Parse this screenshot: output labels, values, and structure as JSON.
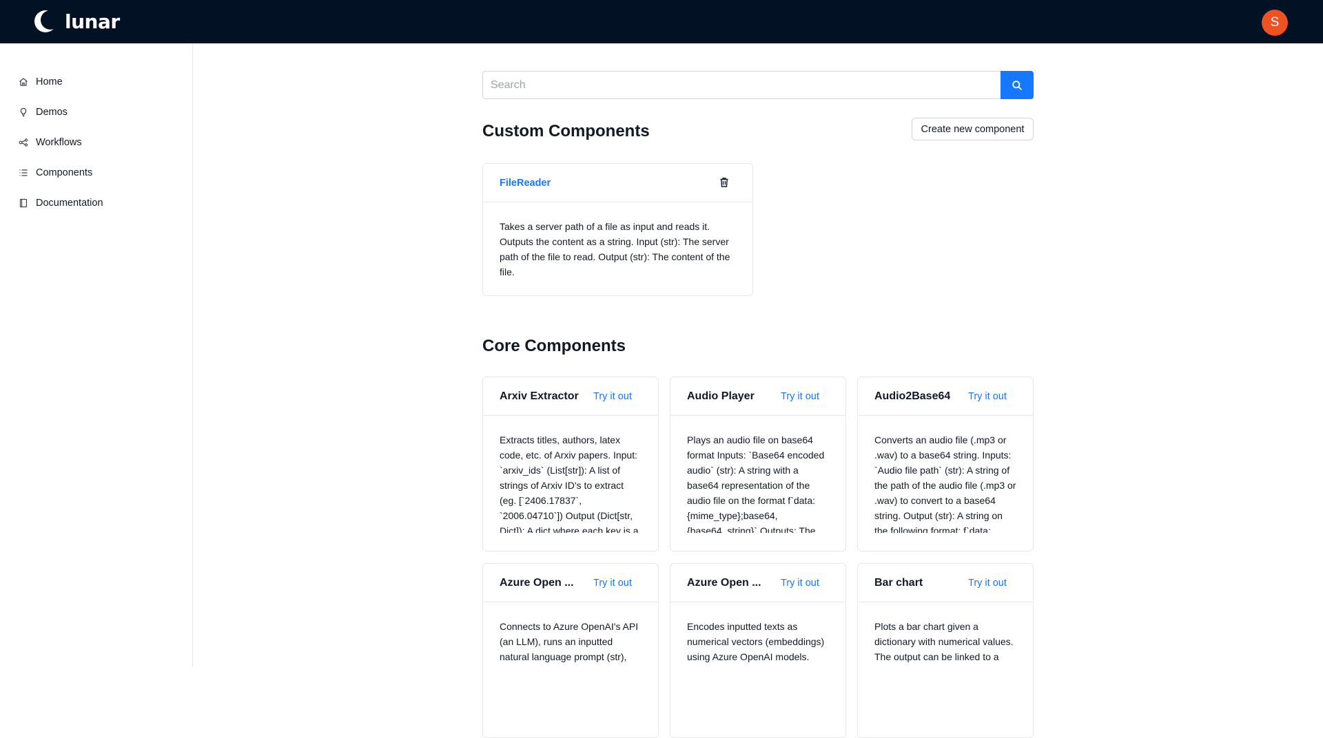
{
  "app": {
    "logo_text": "lunar",
    "avatar_initial": "S",
    "accent_color": "#1677ff",
    "topbar_color": "#021124",
    "avatar_color": "#f05123"
  },
  "sidebar": {
    "items": [
      {
        "label": "Home",
        "icon": "home-icon"
      },
      {
        "label": "Demos",
        "icon": "lightbulb-icon"
      },
      {
        "label": "Workflows",
        "icon": "workflow-icon"
      },
      {
        "label": "Components",
        "icon": "list-icon"
      },
      {
        "label": "Documentation",
        "icon": "book-icon"
      }
    ]
  },
  "search": {
    "placeholder": "Search",
    "value": ""
  },
  "custom": {
    "title": "Custom Components",
    "create_label": "Create new component",
    "cards": [
      {
        "name": "FileReader",
        "description": "Takes a server path of a file as input and reads it. Outputs the content as a string. Input (str): The server path of the file to read. Output (str): The content of the file."
      }
    ]
  },
  "core": {
    "title": "Core Components",
    "try_label": "Try it out",
    "cards": [
      {
        "name": "Arxiv Extractor",
        "description": "Extracts titles, authors, latex code, etc. of Arxiv papers. Input: `arxiv_ids` (List[str]): A list of strings of Arxiv ID's to extract (eg. [`2406.17837`, `2006.04710`]) Output (Dict[str, Dict]): A dict where each key is a"
      },
      {
        "name": "Audio Player",
        "description": "Plays an audio file on base64 format Inputs: `Base64 encoded audio` (str): A string with a base64 representation of the audio file on the format f`data:{mime_type};base64,{base64_string}` Outputs: The"
      },
      {
        "name": "Audio2Base64",
        "description": "Converts an audio file (.mp3 or .wav) to a base64 string. Inputs: `Audio file path` (str): A string of the path of the audio file (.mp3 or .wav) to convert to a base64 string. Output (str): A string on the following format: f`data:"
      },
      {
        "name": "Azure Open ...",
        "description": "Connects to Azure OpenAI's API (an LLM), runs an inputted natural language prompt (str),"
      },
      {
        "name": "Azure Open ...",
        "description": "Encodes inputted texts as numerical vectors (embeddings) using Azure OpenAI models."
      },
      {
        "name": "Bar chart",
        "description": "Plots a bar chart given a dictionary with numerical values. The output can be linked to a"
      }
    ]
  }
}
